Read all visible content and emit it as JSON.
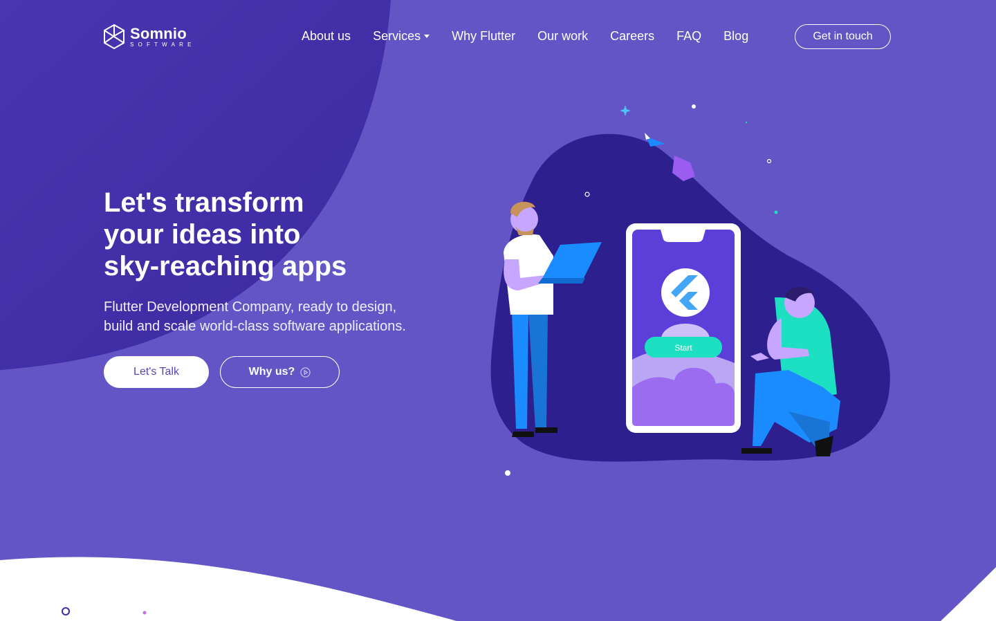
{
  "brand": {
    "name": "Somnio",
    "tagline": "SOFTWARE",
    "icon": "somnio-logo-icon"
  },
  "nav": {
    "items": [
      {
        "label": "About us"
      },
      {
        "label": "Services"
      },
      {
        "label": "Why Flutter"
      },
      {
        "label": "Our work"
      },
      {
        "label": "Careers"
      },
      {
        "label": "FAQ"
      },
      {
        "label": "Blog"
      }
    ],
    "cta": "Get in touch"
  },
  "hero": {
    "title": "Let's transform\nyour ideas into\nsky-reaching apps",
    "subtitle": "Flutter Development Company, ready to design,\nbuild and scale world-class software applications.",
    "primary_button": "Let's Talk",
    "secondary_button": "Why us?"
  },
  "phone": {
    "button_label": "Start"
  },
  "colors": {
    "background": "#6455c7",
    "dark_shape": "#2e1f8f",
    "accent_teal": "#1de0c2",
    "accent_blue": "#1a8cff",
    "button_text": "#5446b6"
  }
}
